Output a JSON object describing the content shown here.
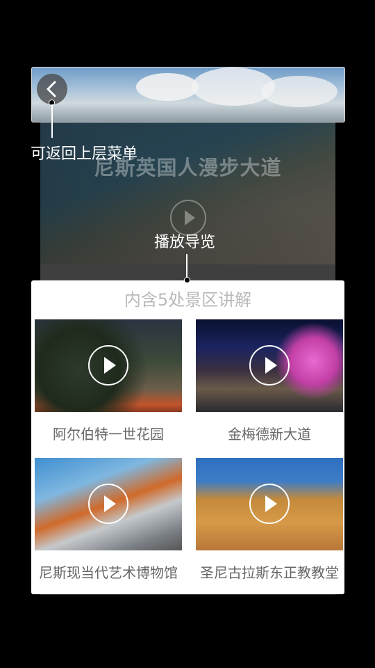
{
  "callouts": {
    "back": "可返回上层菜单",
    "play": "播放导览"
  },
  "hero": {
    "title": "尼斯英国人漫步大道"
  },
  "card": {
    "title": "内含5处景区讲解",
    "items": [
      {
        "label": "阿尔伯特一世花园"
      },
      {
        "label": "金梅德新大道"
      },
      {
        "label": "尼斯现当代艺术博物馆"
      },
      {
        "label": "圣尼古拉斯东正教教堂"
      }
    ]
  },
  "icons": {
    "back": "chevron-left-icon",
    "play": "play-icon"
  }
}
